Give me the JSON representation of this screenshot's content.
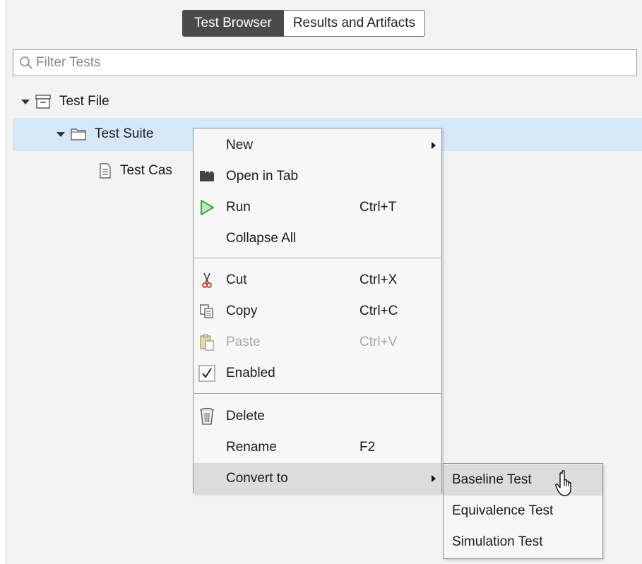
{
  "tabs": [
    {
      "label": "Test Browser",
      "active": true
    },
    {
      "label": "Results and Artifacts",
      "active": false
    }
  ],
  "search": {
    "placeholder": "Filter Tests"
  },
  "tree": {
    "file": {
      "label": "Test File",
      "icon": "test-file-icon"
    },
    "suite": {
      "label": "Test Suite",
      "icon": "folder-icon",
      "selected": true
    },
    "case": {
      "label": "Test Cas",
      "icon": "document-icon"
    }
  },
  "context_menu": {
    "items": [
      {
        "label": "New",
        "shortcut": "",
        "icon": "",
        "submenu": true
      },
      {
        "label": "Open in Tab",
        "shortcut": "",
        "icon": "open-tab-icon"
      },
      {
        "label": "Run",
        "shortcut": "Ctrl+T",
        "icon": "run-icon"
      },
      {
        "label": "Collapse All",
        "shortcut": "",
        "icon": ""
      },
      {
        "label": "Cut",
        "shortcut": "Ctrl+X",
        "icon": "scissors-icon"
      },
      {
        "label": "Copy",
        "shortcut": "Ctrl+C",
        "icon": "copy-icon"
      },
      {
        "label": "Paste",
        "shortcut": "Ctrl+V",
        "icon": "paste-icon",
        "disabled": true
      },
      {
        "label": "Enabled",
        "shortcut": "",
        "icon": "checkmark-icon",
        "checked": true
      },
      {
        "label": "Delete",
        "shortcut": "",
        "icon": "trash-icon"
      },
      {
        "label": "Rename",
        "shortcut": "F2",
        "icon": ""
      },
      {
        "label": "Convert to",
        "shortcut": "",
        "icon": "",
        "submenu": true,
        "highlighted": true
      }
    ]
  },
  "convert_submenu": {
    "items": [
      {
        "label": "Baseline Test",
        "highlighted": true
      },
      {
        "label": "Equivalence Test"
      },
      {
        "label": "Simulation Test"
      }
    ]
  },
  "colors": {
    "selection": "#d6e7f7",
    "active_tab": "#4a4a4a",
    "menu_bg": "#f7f7f7",
    "run_green": "#3cb043",
    "scissors_red": "#c0392b"
  }
}
